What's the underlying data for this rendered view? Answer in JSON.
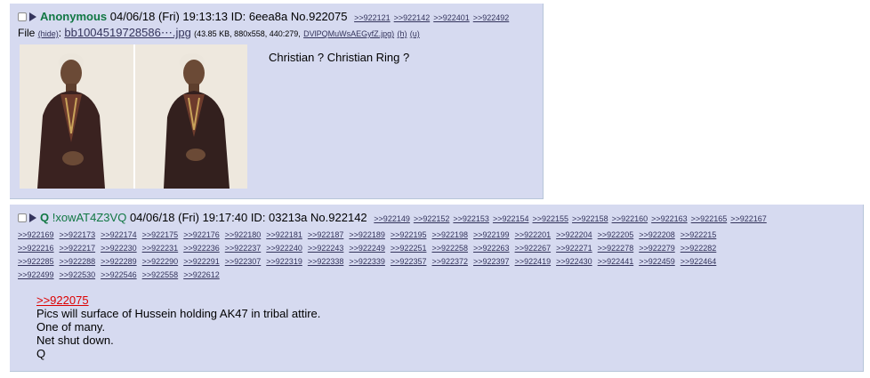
{
  "post1": {
    "name": "Anonymous",
    "datetime": "04/06/18 (Fri) 19:13:13",
    "id_text": "ID: 6eea8a",
    "number": "No.922075",
    "replies": [
      ">>922121",
      ">>922142",
      ">>922401",
      ">>922492"
    ],
    "file_prefix": "File",
    "hide_text": "(hide)",
    "filename": "bb1004519728586⋯.jpg",
    "file_info": "(43.85 KB, 880x558, 440:279,",
    "file_orig": "DVlPQMuWsAEGyfZ.jpg)",
    "file_h": "(h)",
    "file_u": "(u)",
    "message": "Christian ? Christian Ring ?"
  },
  "post2": {
    "name": "Q",
    "tripcode": "!xowAT4Z3VQ",
    "datetime": "04/06/18 (Fri) 19:17:40",
    "id_text": "ID: 03213a",
    "number": "No.922142",
    "header_replies": [
      ">>922149",
      ">>922152",
      ">>922153",
      ">>922154",
      ">>922155",
      ">>922158",
      ">>922160",
      ">>922163",
      ">>922165",
      ">>922167"
    ],
    "reply_rows": [
      [
        ">>922169",
        ">>922173",
        ">>922174",
        ">>922175",
        ">>922176",
        ">>922180",
        ">>922181",
        ">>922187",
        ">>922189",
        ">>922195",
        ">>922198",
        ">>922199",
        ">>922201",
        ">>922204",
        ">>922205",
        ">>922208",
        ">>922215"
      ],
      [
        ">>922216",
        ">>922217",
        ">>922230",
        ">>922231",
        ">>922236",
        ">>922237",
        ">>922240",
        ">>922243",
        ">>922249",
        ">>922251",
        ">>922258",
        ">>922263",
        ">>922267",
        ">>922271",
        ">>922278",
        ">>922279",
        ">>922282"
      ],
      [
        ">>922285",
        ">>922288",
        ">>922289",
        ">>922290",
        ">>922291",
        ">>922307",
        ">>922319",
        ">>922338",
        ">>922339",
        ">>922357",
        ">>922372",
        ">>922397",
        ">>922419",
        ">>922430",
        ">>922441",
        ">>922459",
        ">>922464"
      ],
      [
        ">>922499",
        ">>922530",
        ">>922546",
        ">>922558",
        ">>922612"
      ]
    ],
    "quote_ref": ">>922075",
    "lines": [
      "Pics will surface of Hussein holding AK47 in tribal attire.",
      "One of many.",
      "Net shut down.",
      "Q"
    ]
  },
  "colors": {
    "post_bg": "#d6daf0",
    "name_green": "#117743",
    "link": "#34345c",
    "quote_red": "#dd0000"
  }
}
